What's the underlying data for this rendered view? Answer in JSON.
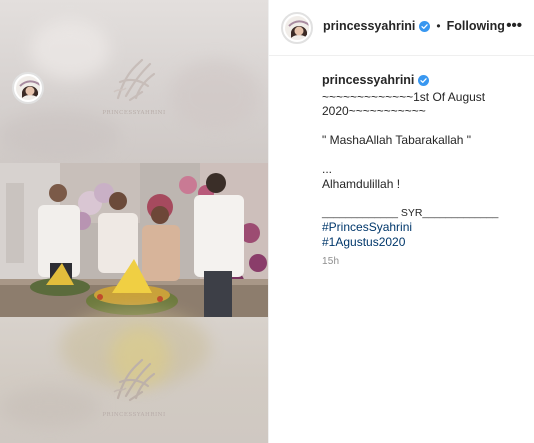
{
  "post": {
    "username": "princessyahrini",
    "follow_state": "Following",
    "separator": "•",
    "more_label": "•••",
    "monogram_text": "PRINCESSYAHRINI",
    "caption_lines": [
      "~~~~~~~~~~~~~1st Of August",
      "2020~~~~~~~~~~~",
      "",
      "\" MashaAllah Tabarakallah \"",
      "",
      "...",
      "Alhamdulillah !",
      "",
      "_____________ SYR_____________"
    ],
    "hashtags": [
      "#PrincesSyahrini",
      "#1Agustus2020"
    ],
    "time_ago": "15h",
    "colors": {
      "verified": "#3897f0",
      "link": "#00376b",
      "muted": "#8e8e8e"
    },
    "icons": {
      "verified": "verified-badge-icon",
      "more": "more-options-icon"
    }
  }
}
